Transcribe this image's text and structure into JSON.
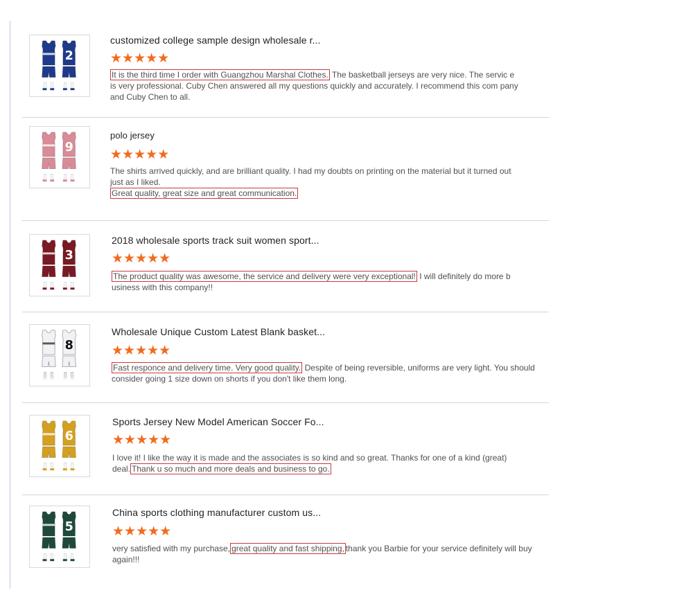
{
  "colors": {
    "star": "#f26b1d",
    "highlight_border": "#c9393c"
  },
  "reviews": [
    {
      "title": "customized college sample design wholesale r...",
      "rating": 5,
      "stars": "★★★★★",
      "text_pre": "",
      "text_highlight": "It is the third time I order with Guangzhou Marshal Clothes.",
      "text_post": " The basketball jerseys are very nice. The servic e is very professional. Cuby Chen answered all my questions quickly and accurately. I recommend this com pany and Cuby Chen to all.",
      "jersey": {
        "color": "#1e3a8a",
        "number": "2",
        "icon": "basketball-jersey-icon"
      }
    },
    {
      "title": "polo jersey",
      "rating": 5,
      "stars": "★★★★★",
      "text_pre": "The shirts arrived quickly, and are brilliant quality. I had my doubts on printing on the material but it turned out just as I liked.",
      "text_highlight": "Great quality, great size and great communication.",
      "text_post": "",
      "jersey": {
        "color": "#d98b97",
        "number": "9",
        "icon": "basketball-jersey-icon"
      }
    },
    {
      "title": "2018 wholesale sports track suit women sport...",
      "rating": 5,
      "stars": "★★★★★",
      "text_pre": "",
      "text_highlight": "The product quality was awesome, the service and delivery were very exceptional!",
      "text_post": " I will definitely do more b usiness with this company!!",
      "jersey": {
        "color": "#7a1a24",
        "number": "3",
        "icon": "basketball-jersey-icon"
      }
    },
    {
      "title": "Wholesale Unique Custom Latest Blank basket...",
      "rating": 5,
      "stars": "★★★★★",
      "text_pre": "",
      "text_highlight": "Fast responce and delivery time. Very good quality.",
      "text_post": " Despite of being reversible, uniforms are very light. You should consider going 1 size down on shorts if you don't like them long.",
      "jersey": {
        "color": "#f2f2f5",
        "number": "8",
        "icon": "basketball-jersey-icon"
      }
    },
    {
      "title": "Sports Jersey New Model American Soccer Fo...",
      "rating": 5,
      "stars": "★★★★★",
      "text_pre": "I love it! I like the way it is made and the associates is so kind and so great. Thanks for one of a kind (great) deal.",
      "text_highlight": "Thank u so much and more deals and business to go.",
      "text_post": "",
      "jersey": {
        "color": "#d4a020",
        "number": "6",
        "icon": "basketball-jersey-icon"
      }
    },
    {
      "title": "China sports clothing manufacturer custom us...",
      "rating": 5,
      "stars": "★★★★★",
      "text_pre": "very satisfied with my purchase,",
      "text_highlight": "great quality and fast shipping,",
      "text_post": "thank you Barbie for your service definitely will buy again!!!",
      "jersey": {
        "color": "#1f4a3a",
        "number": "5",
        "icon": "basketball-jersey-icon"
      }
    }
  ]
}
